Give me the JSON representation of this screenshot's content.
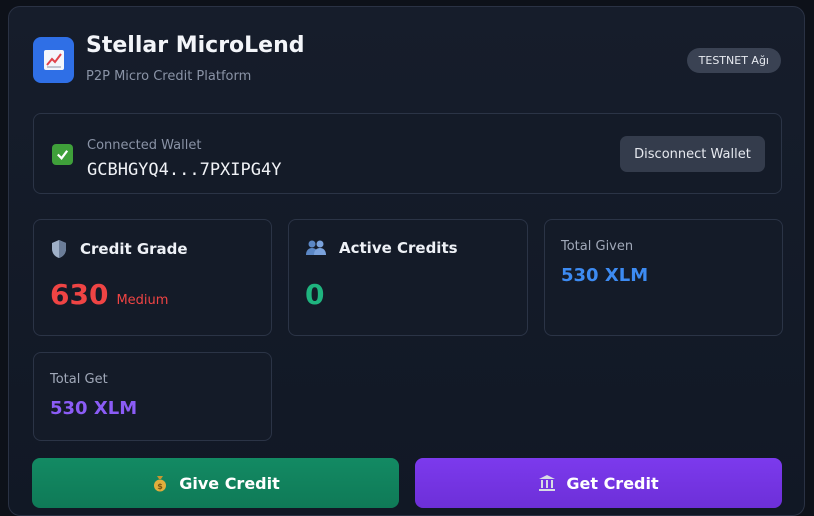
{
  "header": {
    "title": "Stellar MicroLend",
    "subtitle": "P2P Micro Credit Platform",
    "network_badge": "TESTNET Ağı"
  },
  "wallet": {
    "label": "Connected Wallet",
    "address": "GCBHGYQ4...7PXIPG4Y",
    "disconnect_label": "Disconnect Wallet"
  },
  "stats": {
    "credit_grade": {
      "label": "Credit Grade",
      "value": "630",
      "rating": "Medium"
    },
    "active_credits": {
      "label": "Active Credits",
      "value": "0"
    },
    "total_given": {
      "label": "Total Given",
      "value": "530 XLM"
    },
    "total_get": {
      "label": "Total Get",
      "value": "530 XLM"
    }
  },
  "actions": {
    "give_label": "Give Credit",
    "get_label": "Get Credit"
  },
  "colors": {
    "accent_blue": "#3d8bf2",
    "grade_red": "#ef4444",
    "active_green": "#1fb47f",
    "purple": "#8b5cf6",
    "give_button": "#0f8c63",
    "get_button": "#7a38e0"
  },
  "icons": {
    "logo": "chart-up-icon",
    "connected": "check-icon",
    "credit_grade": "shield-icon",
    "active_credits": "users-icon",
    "give": "money-bag-icon",
    "get": "bank-icon"
  }
}
